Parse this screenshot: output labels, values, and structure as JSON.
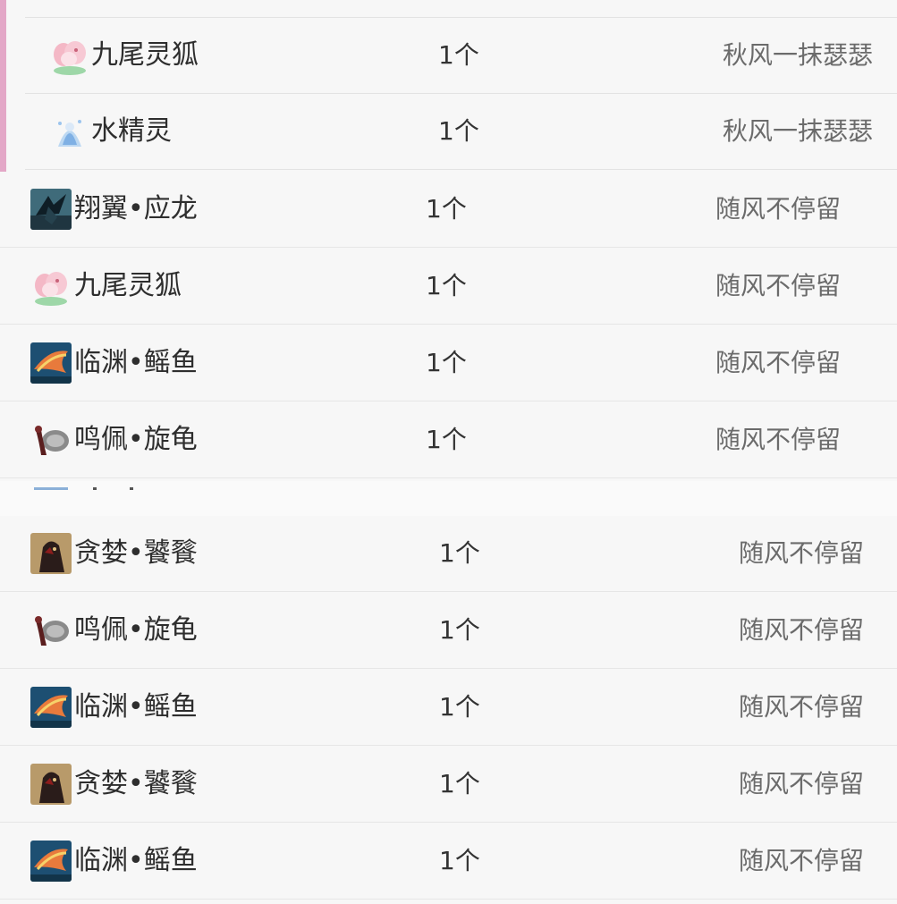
{
  "colors": {
    "accent_bar": "#e3a7c7",
    "divider": "#e4e4e4",
    "owner_text": "#6b6b6b"
  },
  "panel1": {
    "rows": [
      {
        "name": "九尾灵狐",
        "qty": "1个",
        "owner": "秋风一抹瑟瑟",
        "icon": "nine-tailed-fox-icon"
      },
      {
        "name": "水精灵",
        "qty": "1个",
        "owner": "秋风一抹瑟瑟",
        "icon": "water-spirit-icon"
      }
    ]
  },
  "panel2": {
    "rows": [
      {
        "name": "翔翼•应龙",
        "qty": "1个",
        "owner": "随风不停留",
        "icon": "winged-dragon-icon"
      },
      {
        "name": "九尾灵狐",
        "qty": "1个",
        "owner": "随风不停留",
        "icon": "nine-tailed-fox-icon"
      },
      {
        "name": "临渊•鳐鱼",
        "qty": "1个",
        "owner": "随风不停留",
        "icon": "ray-fish-icon"
      },
      {
        "name": "鸣佩•旋龟",
        "qty": "1个",
        "owner": "随风不停留",
        "icon": "spiral-turtle-icon"
      }
    ]
  },
  "panel3": {
    "rows": [
      {
        "name": "贪婪•饕餮",
        "qty": "1个",
        "owner": "随风不停留",
        "icon": "taotie-icon"
      },
      {
        "name": "鸣佩•旋龟",
        "qty": "1个",
        "owner": "随风不停留",
        "icon": "spiral-turtle-icon"
      },
      {
        "name": "临渊•鳐鱼",
        "qty": "1个",
        "owner": "随风不停留",
        "icon": "ray-fish-icon"
      },
      {
        "name": "贪婪•饕餮",
        "qty": "1个",
        "owner": "随风不停留",
        "icon": "taotie-icon"
      },
      {
        "name": "临渊•鳐鱼",
        "qty": "1个",
        "owner": "随风不停留",
        "icon": "ray-fish-icon"
      }
    ]
  }
}
